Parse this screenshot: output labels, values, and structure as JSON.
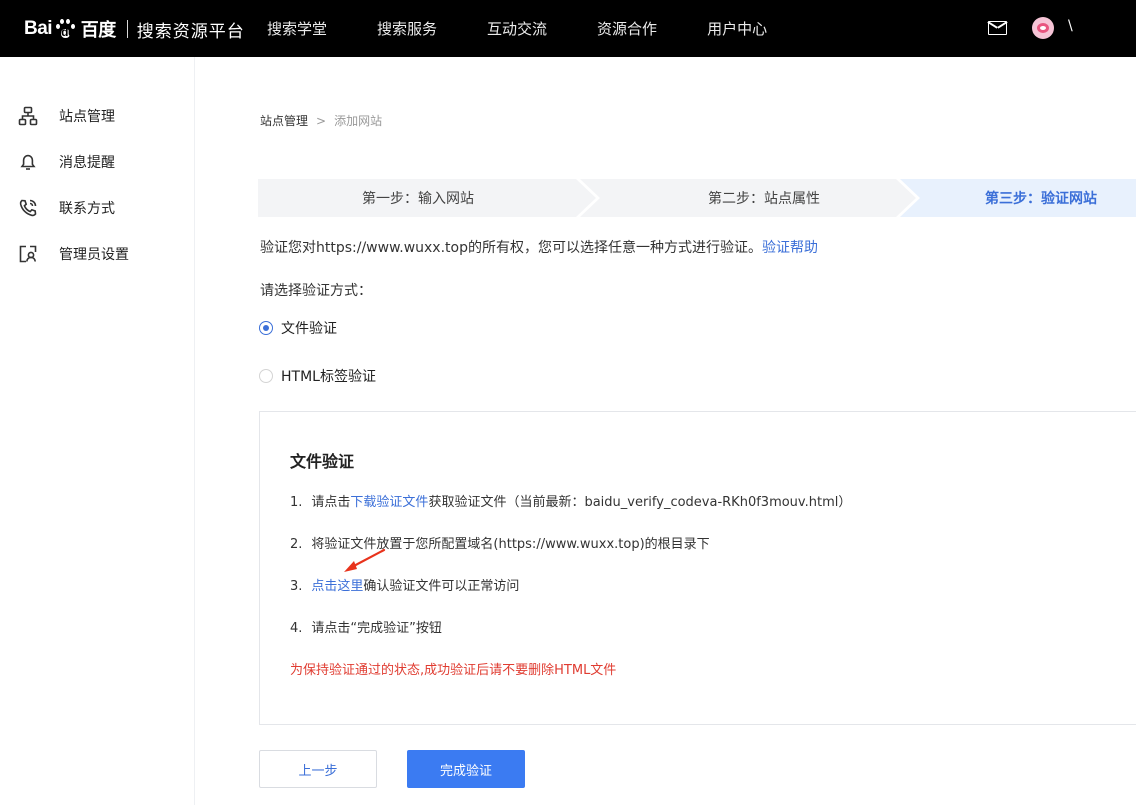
{
  "header": {
    "logo_latin": "Bai",
    "logo_latin2": "du",
    "logo_cn": "百度",
    "logo_sub": "搜索资源平台",
    "nav": [
      "搜索学堂",
      "搜索服务",
      "互动交流",
      "资源合作",
      "用户中心"
    ],
    "username": "\\"
  },
  "sidebar": {
    "items": [
      {
        "label": "站点管理",
        "icon": "sitemap-icon"
      },
      {
        "label": "消息提醒",
        "icon": "bell-icon"
      },
      {
        "label": "联系方式",
        "icon": "phone-icon"
      },
      {
        "label": "管理员设置",
        "icon": "admin-icon"
      }
    ]
  },
  "breadcrumb": {
    "root": "站点管理",
    "sep": ">",
    "current": "添加网站"
  },
  "steps": [
    {
      "label": "第一步：输入网站",
      "active": false
    },
    {
      "label": "第二步：站点属性",
      "active": false
    },
    {
      "label": "第三步：验证网站",
      "active": true
    }
  ],
  "intro": {
    "text": "验证您对https://www.wuxx.top的所有权，您可以选择任意一种方式进行验证。",
    "help_link": "验证帮助"
  },
  "choose_label": "请选择验证方式：",
  "methods": [
    {
      "label": "文件验证",
      "checked": true
    },
    {
      "label": "HTML标签验证",
      "checked": false
    }
  ],
  "panel": {
    "title": "文件验证",
    "step1": {
      "num": "1.",
      "pre": "请点击",
      "link": "下载验证文件",
      "post": "获取验证文件（当前最新：baidu_verify_codeva-RKh0f3mouv.html）"
    },
    "step2": {
      "num": "2.",
      "text": "将验证文件放置于您所配置域名(https://www.wuxx.top)的根目录下"
    },
    "step3": {
      "num": "3.",
      "link": "点击这里",
      "post": "确认验证文件可以正常访问"
    },
    "step4": {
      "num": "4.",
      "text": "请点击“完成验证”按钮"
    },
    "warning": "为保持验证通过的状态,成功验证后请不要删除HTML文件"
  },
  "buttons": {
    "prev": "上一步",
    "done": "完成验证"
  },
  "colors": {
    "accent": "#3b6fd8",
    "primary_button": "#3b7bf2",
    "warning": "#e03c31",
    "annotation_arrow": "#e8331c"
  }
}
